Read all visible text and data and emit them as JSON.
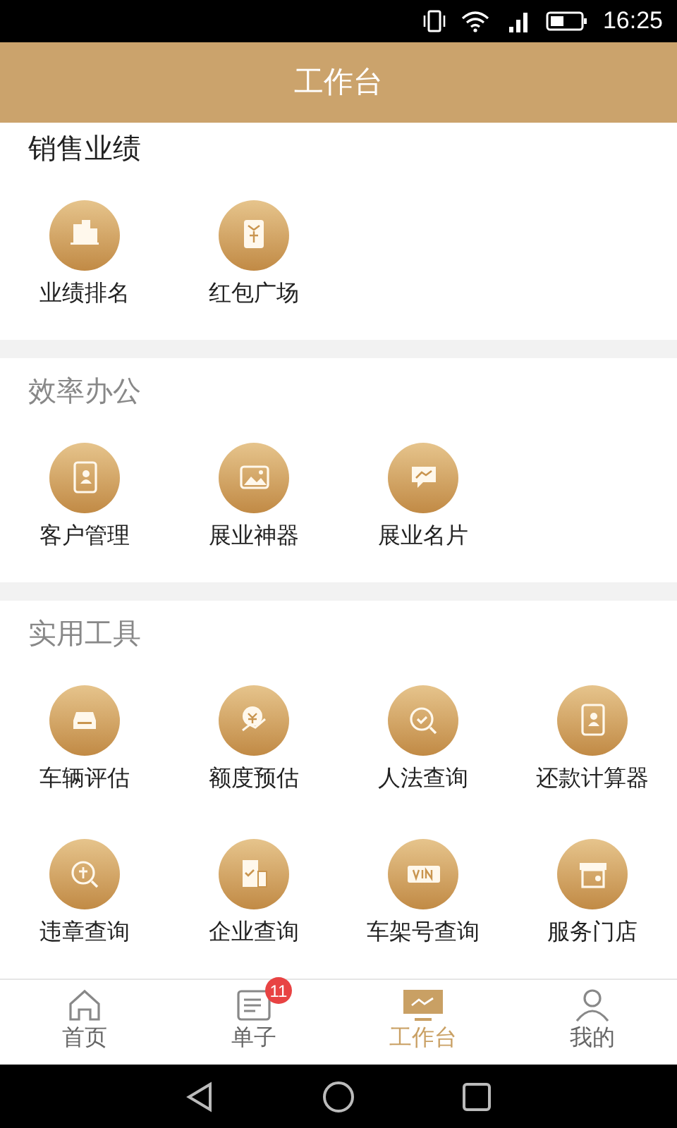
{
  "status_bar": {
    "time": "16:25"
  },
  "header": {
    "title": "工作台"
  },
  "sections": [
    {
      "title": "销售业绩",
      "emphasis": true,
      "items": [
        {
          "label": "业绩排名"
        },
        {
          "label": "红包广场"
        }
      ]
    },
    {
      "title": "效率办公",
      "emphasis": false,
      "items": [
        {
          "label": "客户管理"
        },
        {
          "label": "展业神器"
        },
        {
          "label": "展业名片"
        }
      ]
    },
    {
      "title": "实用工具",
      "emphasis": false,
      "items": [
        {
          "label": "车辆评估"
        },
        {
          "label": "额度预估"
        },
        {
          "label": "人法查询"
        },
        {
          "label": "还款计算器"
        },
        {
          "label": "违章查询"
        },
        {
          "label": "企业查询"
        },
        {
          "label": "车架号查询"
        },
        {
          "label": "服务门店"
        }
      ]
    }
  ],
  "tab_bar": [
    {
      "label": "首页",
      "selected": false
    },
    {
      "label": "单子",
      "selected": false,
      "badge": "11"
    },
    {
      "label": "工作台",
      "selected": true
    },
    {
      "label": "我的",
      "selected": false
    }
  ]
}
